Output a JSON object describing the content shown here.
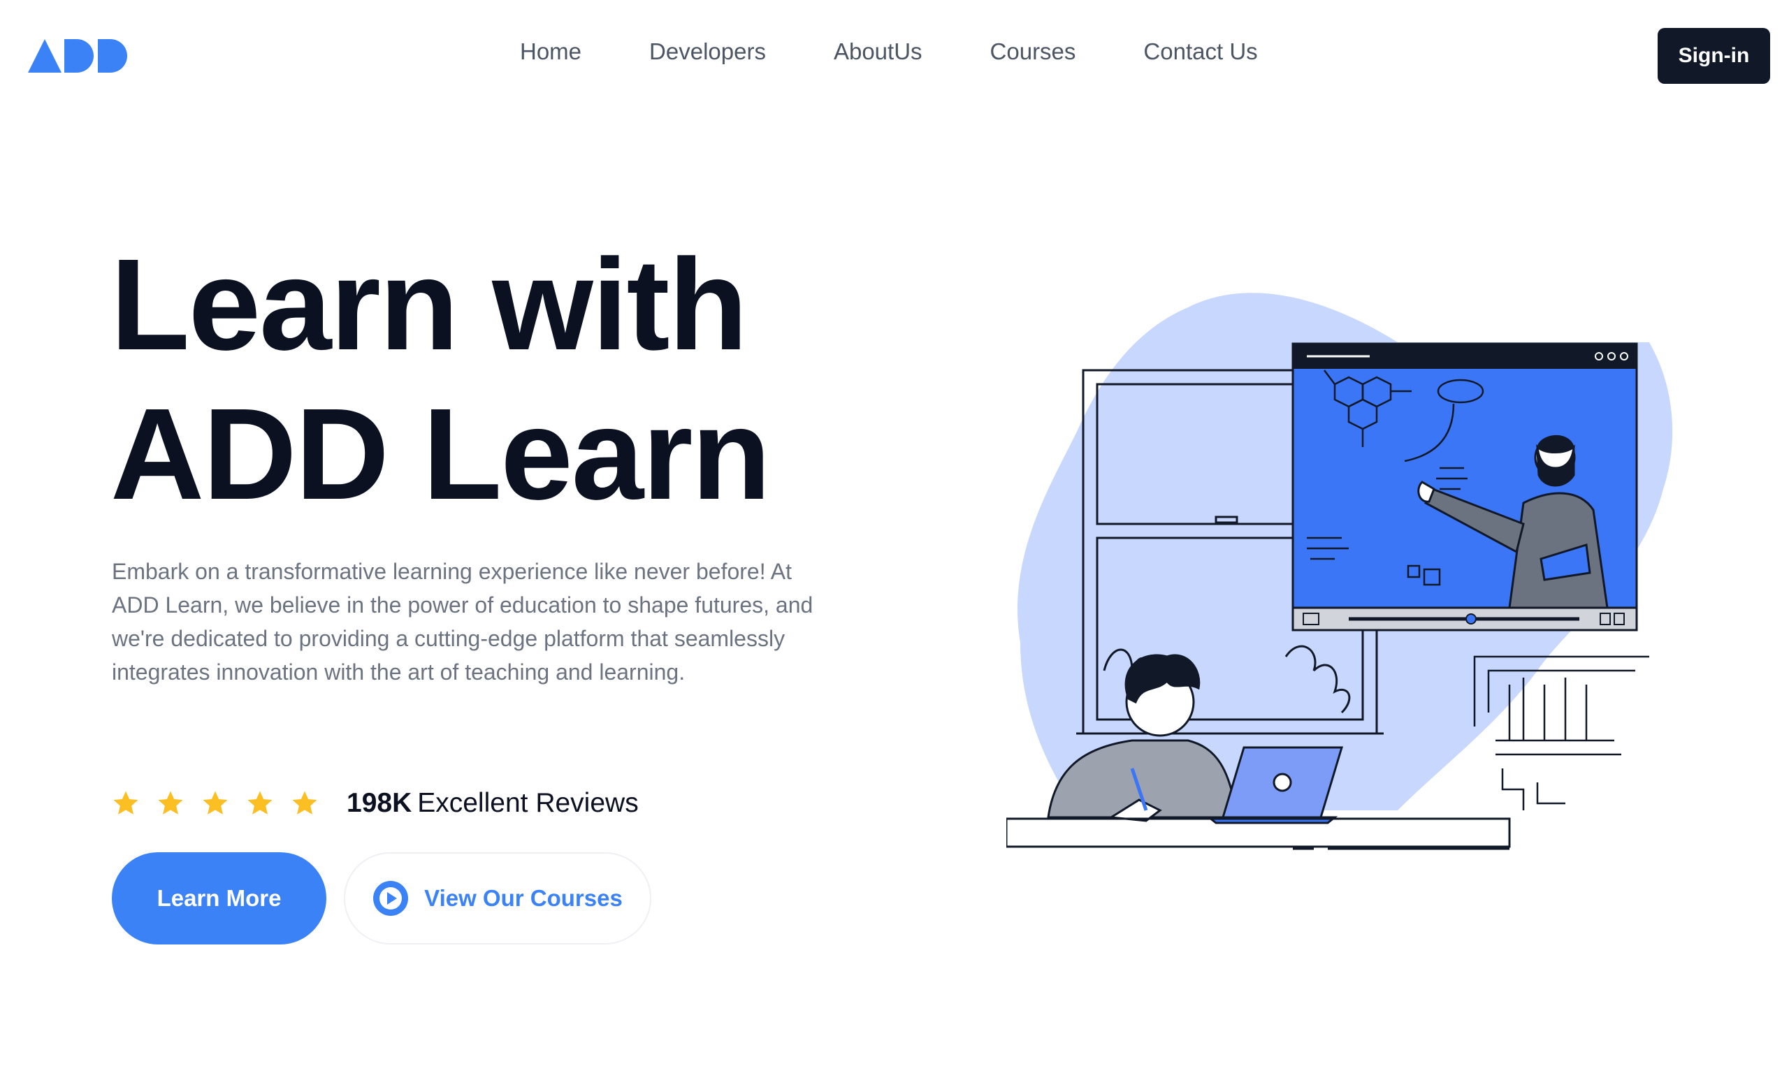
{
  "brand": {
    "logo_text": "ADD",
    "accent": "#3b82f6",
    "dark": "#111827"
  },
  "nav": {
    "links": [
      {
        "label": "Home"
      },
      {
        "label": "Developers"
      },
      {
        "label": "AboutUs"
      },
      {
        "label": "Courses"
      },
      {
        "label": "Contact Us"
      }
    ],
    "signin_label": "Sign-in"
  },
  "hero": {
    "title_line1": "Learn with",
    "title_line2": "ADD Learn",
    "description": "Embark on a transformative learning experience like never before! At ADD Learn, we believe in the power of education to shape futures, and we're dedicated to providing a cutting-edge platform that seamlessly integrates innovation with the art of teaching and learning.",
    "rating": {
      "stars": 5,
      "star_color": "#fbbf24",
      "icon": "star-icon"
    },
    "reviews_count": "198K",
    "reviews_label": "Excellent Reviews",
    "primary_button": "Learn More",
    "secondary_button": "View Our Courses",
    "secondary_icon": "play-icon"
  },
  "illustration": {
    "icon": "online-learning-illustration",
    "blob_color": "#c7d7fe",
    "screen_color": "#3b76f6"
  }
}
